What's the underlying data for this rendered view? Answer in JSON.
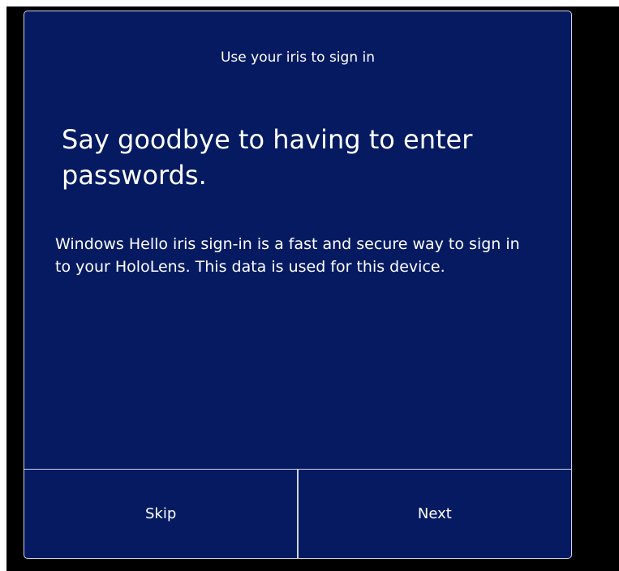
{
  "dialog": {
    "title": "Use your iris to sign in",
    "headline": "Say goodbye to having to enter passwords.",
    "body": "Windows Hello iris sign-in is a fast and secure way to sign in to your HoloLens. This data is used for this device.",
    "buttons": {
      "skip_label": "Skip",
      "next_label": "Next"
    }
  },
  "colors": {
    "dialog_background": "#061a62",
    "border": "#d0d4e4",
    "text": "#ffffff",
    "backdrop": "#000000"
  }
}
